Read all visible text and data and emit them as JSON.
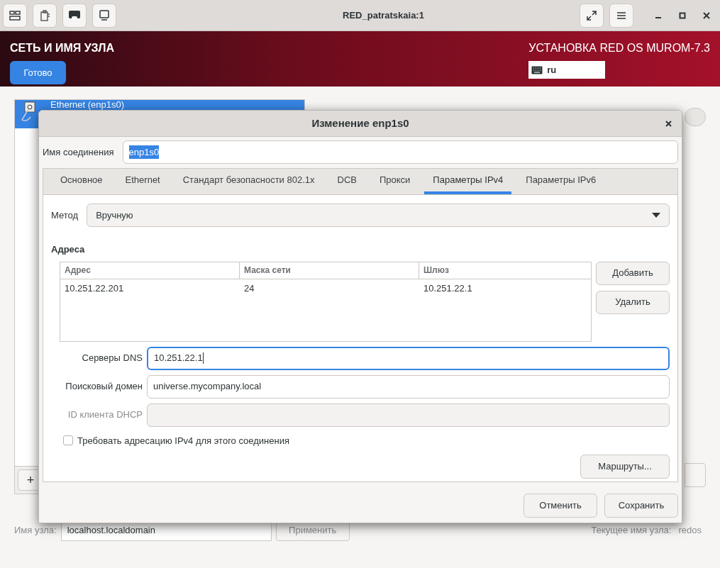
{
  "window": {
    "title": "RED_patratskaia:1"
  },
  "header": {
    "title": "СЕТЬ И ИМЯ УЗЛА",
    "done_button": "Готово",
    "product": "УСТАНОВКА RED OS MUROM-7.3",
    "keyboard_layout": "ru"
  },
  "background": {
    "switch_on": false,
    "connections": [
      {
        "name": "Ethernet (enp1s0)",
        "selected": true
      }
    ],
    "add_button": "+",
    "hostname_label": "Имя узла:",
    "hostname_value": "localhost.localdomain",
    "apply_button": "Применить",
    "current_hostname_label": "Текущее имя узла:",
    "current_hostname": "redos"
  },
  "dialog": {
    "title": "Изменение enp1s0",
    "connection_name_label": "Имя соединения",
    "connection_name": "enp1s0",
    "tabs": [
      {
        "label": "Основное",
        "selected": false
      },
      {
        "label": "Ethernet",
        "selected": false
      },
      {
        "label": "Стандарт безопасности 802.1x",
        "selected": false
      },
      {
        "label": "DCB",
        "selected": false
      },
      {
        "label": "Прокси",
        "selected": false
      },
      {
        "label": "Параметры IPv4",
        "selected": true
      },
      {
        "label": "Параметры IPv6",
        "selected": false
      }
    ],
    "method_label": "Метод",
    "method": "Вручную",
    "addresses_heading": "Адреса",
    "table": {
      "columns": [
        "Адрес",
        "Маска сети",
        "Шлюз"
      ],
      "rows": [
        [
          "10.251.22.201",
          "24",
          "10.251.22.1"
        ]
      ]
    },
    "add_button": "Добавить",
    "delete_button": "Удалить",
    "fields": [
      {
        "label": "Серверы DNS",
        "value": "10.251.22.1",
        "focused": true,
        "disabled": false
      },
      {
        "label": "Поисковый домен",
        "value": "universe.mycompany.local",
        "focused": false,
        "disabled": false
      },
      {
        "label": "ID клиента DHCP",
        "focused": false,
        "disabled": true
      }
    ],
    "require_ipv4": {
      "label": "Требовать адресацию IPv4 для этого соединения",
      "checked": false
    },
    "routes_button": "Маршруты...",
    "cancel_button": "Отменить",
    "save_button": "Сохранить"
  }
}
